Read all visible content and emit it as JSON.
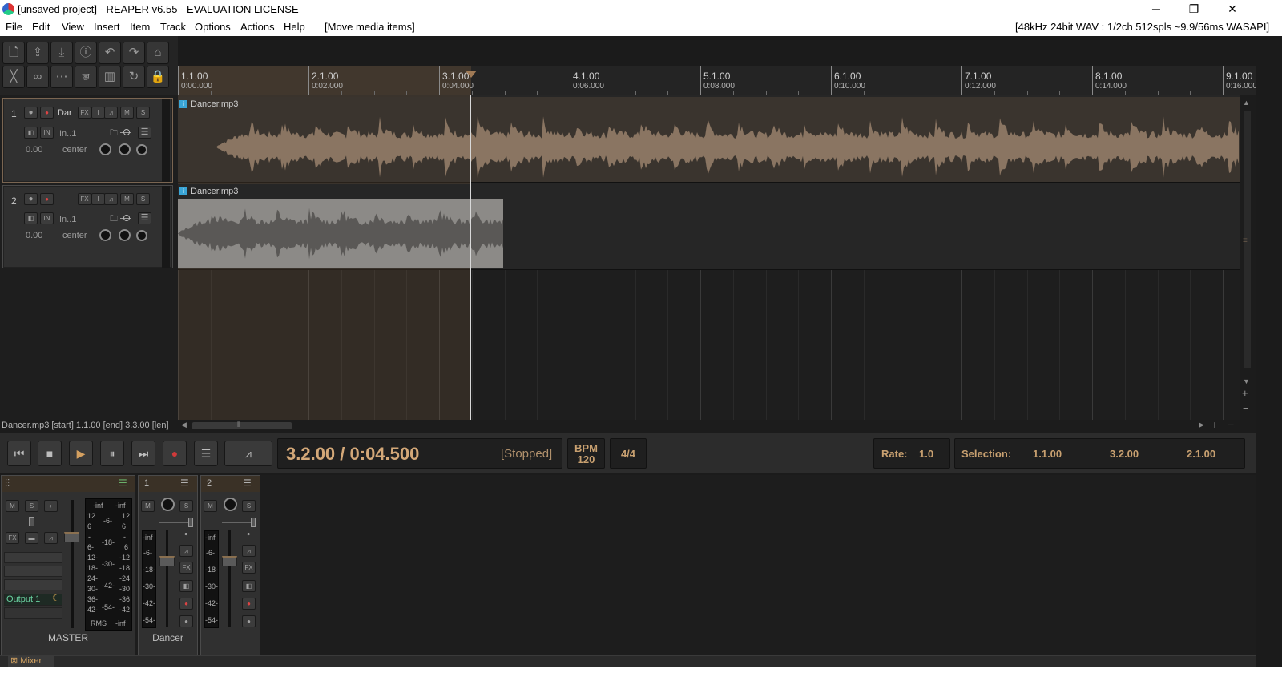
{
  "window": {
    "title": "[unsaved project] - REAPER v6.55 - EVALUATION LICENSE",
    "min_glyph": "─",
    "max_glyph": "❐",
    "close_glyph": "✕"
  },
  "menu": {
    "items": [
      "File",
      "Edit",
      "View",
      "Insert",
      "Item",
      "Track",
      "Options",
      "Actions",
      "Help"
    ],
    "last_action": "[Move media items]",
    "audio_status": "[48kHz 24bit WAV : 1/2ch 512spls ~9.9/56ms WASAPI]"
  },
  "toolbar": {
    "buttons": [
      {
        "icon": "new-project-icon",
        "glyph": "🗋"
      },
      {
        "icon": "open-project-icon",
        "glyph": "⇪"
      },
      {
        "icon": "save-project-icon",
        "glyph": "⤓"
      },
      {
        "icon": "project-settings-icon",
        "glyph": "ⓘ"
      },
      {
        "icon": "undo-icon",
        "glyph": "↶"
      },
      {
        "icon": "redo-icon",
        "glyph": "↷"
      },
      {
        "icon": "metronome-icon",
        "glyph": "⌂"
      },
      {
        "icon": "ripple-edit-icon",
        "glyph": "╳"
      },
      {
        "icon": "grouping-icon",
        "glyph": "∞"
      },
      {
        "icon": "auto-crossfade-icon",
        "glyph": "⋯"
      },
      {
        "icon": "envelope-move-icon",
        "glyph": "⩐"
      },
      {
        "icon": "snap-grid-icon",
        "glyph": "▥"
      },
      {
        "icon": "loop-icon",
        "glyph": "↻"
      },
      {
        "icon": "lock-icon",
        "glyph": "🔒"
      }
    ]
  },
  "ruler": {
    "marks": [
      {
        "bar": "1.1.00",
        "time": "0:00.000"
      },
      {
        "bar": "2.1.00",
        "time": "0:02.000"
      },
      {
        "bar": "3.1.00",
        "time": "0:04.000"
      },
      {
        "bar": "4.1.00",
        "time": "0:06.000"
      },
      {
        "bar": "5.1.00",
        "time": "0:08.000"
      },
      {
        "bar": "6.1.00",
        "time": "0:10.000"
      },
      {
        "bar": "7.1.00",
        "time": "0:12.000"
      },
      {
        "bar": "8.1.00",
        "time": "0:14.000"
      },
      {
        "bar": "9.1.00",
        "time": "0:16.000"
      }
    ]
  },
  "tracks": [
    {
      "num": "1",
      "name": "Dar",
      "input": "In..1",
      "volume": "0.00",
      "pan": "center",
      "item_name": "Dancer.mp3",
      "selected": true
    },
    {
      "num": "2",
      "name": "",
      "input": "In..1",
      "volume": "0.00",
      "pan": "center",
      "item_name": "Dancer.mp3",
      "selected": false
    }
  ],
  "track_buttons": {
    "fx": "FX",
    "io": "I",
    "env": "⩘",
    "mute": "M",
    "solo": "S",
    "rec": "●",
    "phase": "IN"
  },
  "status_line": "Dancer.mp3 [start] 1.1.00 [end] 3.3.00 [len]",
  "transport": {
    "position": "3.2.00 / 0:04.500",
    "state": "[Stopped]",
    "bpm_label": "BPM",
    "bpm": "120",
    "time_sig": "4/4",
    "rate_label": "Rate:",
    "rate": "1.0",
    "selection_label": "Selection:",
    "sel_start": "1.1.00",
    "sel_end": "3.2.00",
    "sel_len": "2.1.00",
    "buttons": {
      "prev": "⏮",
      "stop": "■",
      "play": "▶",
      "pause": "⏸",
      "next": "⏭",
      "record": "●",
      "repeat": "☰",
      "automation": "⩘"
    }
  },
  "mixer": {
    "master_name": "MASTER",
    "output": "Output 1",
    "strips": [
      {
        "num": "1",
        "name": "Dancer"
      },
      {
        "num": "2",
        "name": ""
      }
    ],
    "meter_top": [
      "-inf",
      "-inf"
    ],
    "master_scale": [
      "12",
      "6",
      "-",
      "6-",
      "12-",
      "18-",
      "24-",
      "30-",
      "36-",
      "42-"
    ],
    "master_scale_r": [
      "12",
      "6",
      "-",
      "6",
      "-12",
      "-18",
      "-24",
      "-30",
      "-36",
      "-42"
    ],
    "center_scale": [
      "-6-",
      "-18-",
      "-30-",
      "-42-",
      "-54-"
    ],
    "strip_scale": [
      "-inf",
      "-6-",
      "-18-",
      "-30-",
      "-42-",
      "-54-"
    ],
    "rms": "RMS",
    "rms_val": "-inf",
    "tab_label": "Mixer"
  }
}
